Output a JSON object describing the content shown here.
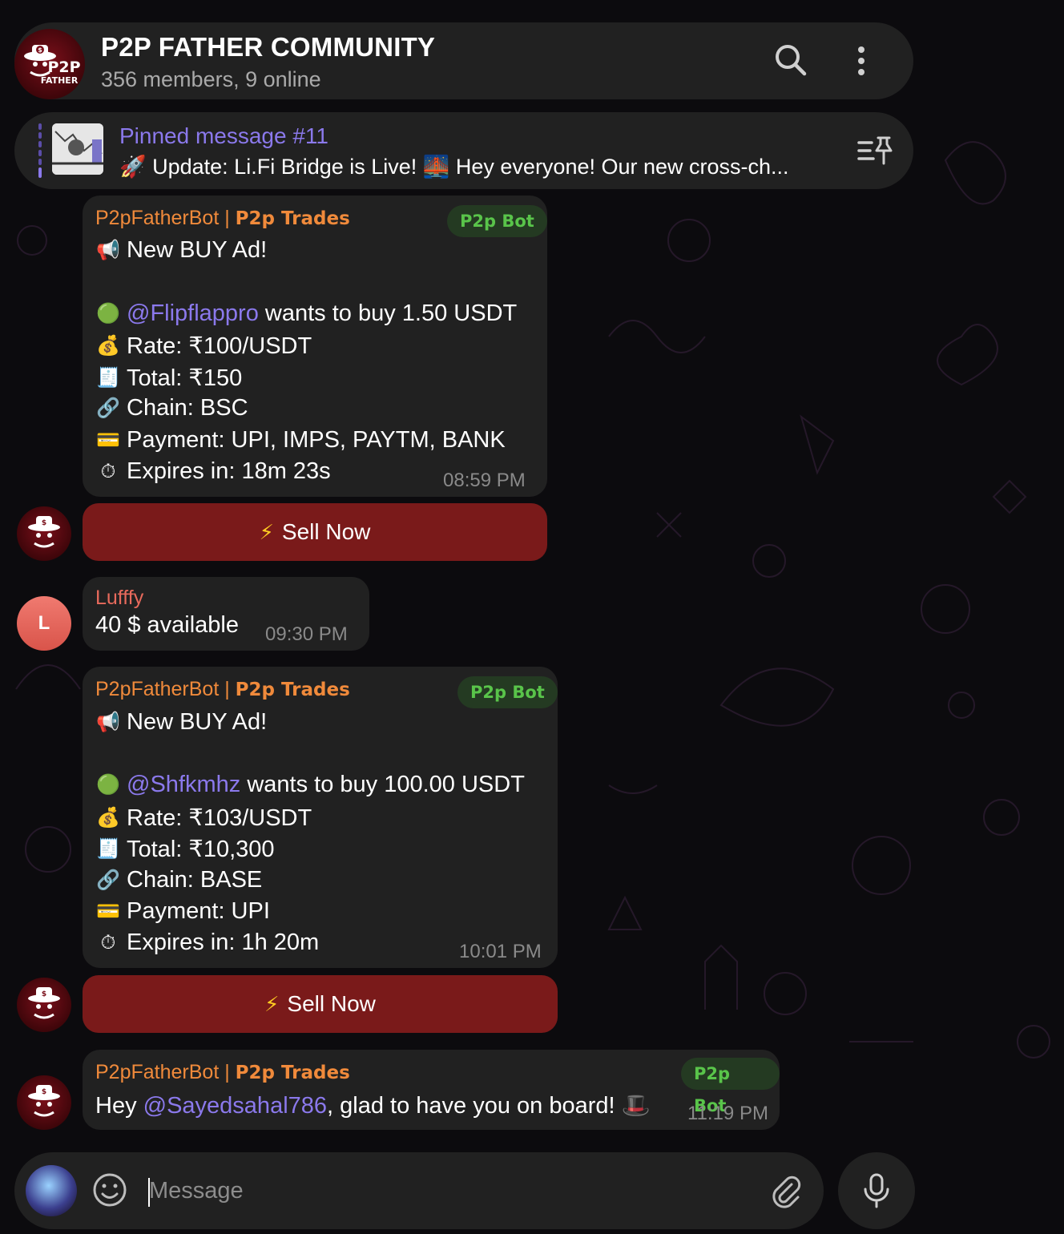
{
  "header": {
    "title": "P2P FATHER COMMUNITY",
    "subtitle": "356 members, 9 online",
    "avatar_text": [
      "P2P",
      "FATHER"
    ]
  },
  "pinned": {
    "title": "Pinned message #11",
    "text": "🚀 Update: Li.Fi Bridge is Live! 🌉 Hey everyone! Our new cross-ch..."
  },
  "messages": [
    {
      "sender_name": "P2pFatherBot | ",
      "sender_tag": "P2p Trades",
      "badge": "P2p Bot",
      "heading_emoji": "📢",
      "heading": "New BUY Ad!",
      "buy_emoji": "🟢",
      "user": "@Flipflappro",
      "action": " wants to buy ",
      "amount": "1.50 USDT",
      "rate_emoji": "💰",
      "rate": "Rate: ₹100/USDT",
      "total_emoji": "🧾",
      "total": "Total: ₹150",
      "chain_emoji": "🔗",
      "chain": "Chain: BSC",
      "payment_emoji": "💳",
      "payment": "Payment: UPI, IMPS, PAYTM, BANK",
      "expires_emoji": "⏱",
      "expires": "Expires in: 18m 23s",
      "time": "08:59 PM",
      "button_label": "Sell Now"
    },
    {
      "sender_name": "Lufffy",
      "avatar_letter": "L",
      "text": "40 $ available",
      "time": "09:30 PM"
    },
    {
      "sender_name": "P2pFatherBot | ",
      "sender_tag": "P2p Trades",
      "badge": "P2p Bot",
      "heading_emoji": "📢",
      "heading": "New BUY Ad!",
      "buy_emoji": "🟢",
      "user": "@Shfkmhz",
      "action": " wants to buy ",
      "amount": "100.00 USDT",
      "rate_emoji": "💰",
      "rate": "Rate: ₹103/USDT",
      "total_emoji": "🧾",
      "total": "Total: ₹10,300",
      "chain_emoji": "🔗",
      "chain": "Chain: BASE",
      "payment_emoji": "💳",
      "payment": "Payment: UPI",
      "expires_emoji": "⏱",
      "expires": "Expires in: 1h 20m",
      "time": "10:01 PM",
      "button_label": "Sell Now"
    },
    {
      "sender_name": "P2pFatherBot | ",
      "sender_tag": "P2p Trades",
      "badge": "P2p Bot",
      "text_prefix": "Hey ",
      "user": "@Sayedsahal786",
      "text_suffix": ", glad to have you on board! 🎩",
      "time": "11:19 PM"
    }
  ],
  "composer": {
    "placeholder": "Message"
  },
  "colors": {
    "accent": "#8b79ec",
    "sender": "#f08a3b",
    "badge_text": "#59c44a",
    "sell_button": "#7a1a1a",
    "bubble": "#212121"
  },
  "icons": [
    "search-icon",
    "more-vertical-icon",
    "unpin-icon",
    "emoji-icon",
    "attach-icon",
    "mic-icon",
    "lightning-icon"
  ]
}
